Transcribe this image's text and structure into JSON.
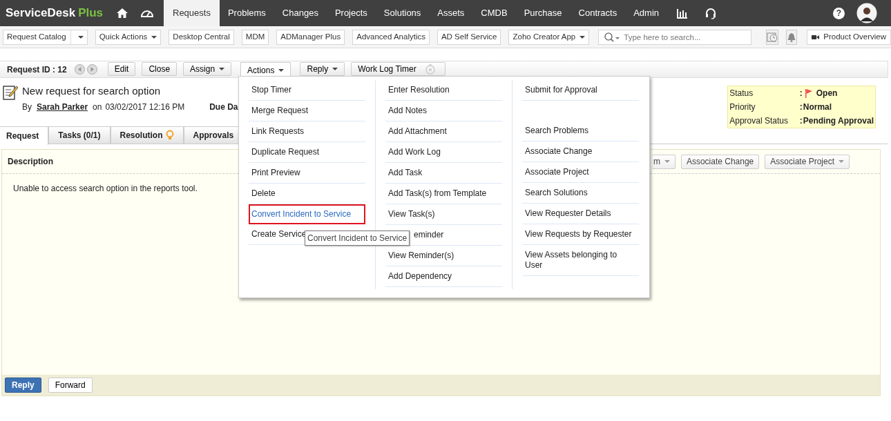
{
  "header": {
    "logo_main": "ServiceDesk",
    "logo_accent": "Plus",
    "help": "?",
    "nav": [
      {
        "label": "Requests",
        "selected": true
      },
      {
        "label": "Problems",
        "selected": false
      },
      {
        "label": "Changes",
        "selected": false
      },
      {
        "label": "Projects",
        "selected": false
      },
      {
        "label": "Solutions",
        "selected": false
      },
      {
        "label": "Assets",
        "selected": false
      },
      {
        "label": "CMDB",
        "selected": false
      },
      {
        "label": "Purchase",
        "selected": false
      },
      {
        "label": "Contracts",
        "selected": false
      },
      {
        "label": "Admin",
        "selected": false
      }
    ]
  },
  "toolbar": {
    "items": [
      {
        "label": "Request Catalog",
        "kind": "split"
      },
      {
        "label": "Quick Actions",
        "kind": "dropdown"
      },
      {
        "label": "Desktop Central",
        "kind": "plain"
      },
      {
        "label": "MDM",
        "kind": "plain"
      },
      {
        "label": "ADManager Plus",
        "kind": "plain"
      },
      {
        "label": "Advanced Analytics",
        "kind": "plain"
      },
      {
        "label": "AD Self Service",
        "kind": "plain"
      },
      {
        "label": "Zoho Creator App",
        "kind": "dropdown"
      }
    ],
    "search": {
      "placeholder": "Type here to search..."
    },
    "product_overview": "Product Overview"
  },
  "request_bar": {
    "id_label": "Request ID : 12",
    "buttons": [
      {
        "label": "Edit",
        "dropdown": false,
        "active": false
      },
      {
        "label": "Close",
        "dropdown": false,
        "active": false
      },
      {
        "label": "Assign",
        "dropdown": true,
        "active": false
      },
      {
        "label": "Actions",
        "dropdown": true,
        "active": true
      },
      {
        "label": "Reply",
        "dropdown": true,
        "active": false
      }
    ],
    "timer": "Work Log Timer"
  },
  "request": {
    "title": "New request for search option",
    "by": "By",
    "author": "Sarah Parker",
    "on": "on",
    "date": "03/02/2017 12:16 PM",
    "due": "Due Da"
  },
  "summary": [
    {
      "label": "Status",
      "colon": ":",
      "value": "Open",
      "flag": true
    },
    {
      "label": "Priority",
      "colon": ":",
      "value": "Normal",
      "flag": false
    },
    {
      "label": "Approval Status",
      "colon": ":",
      "value": "Pending Approval",
      "flag": false
    }
  ],
  "tabs": [
    {
      "label": "Request",
      "selected": true,
      "bulb": false
    },
    {
      "label": "Tasks (0/1)",
      "selected": false,
      "bulb": false
    },
    {
      "label": "Resolution",
      "selected": false,
      "bulb": true
    },
    {
      "label": "Approvals",
      "selected": false,
      "bulb": false
    }
  ],
  "panel": {
    "heading": "Description",
    "buttons": [
      {
        "label": "m",
        "dropdown": true
      },
      {
        "label": "Associate Change",
        "dropdown": false
      },
      {
        "label": "Associate Project",
        "dropdown": true
      }
    ],
    "body": "Unable to access search option in the reports tool.",
    "footer": [
      {
        "label": "Reply",
        "primary": true
      },
      {
        "label": "Forward",
        "primary": false
      }
    ]
  },
  "actions_menu": {
    "tooltip": "Convert Incident to Service",
    "columns": [
      [
        {
          "label": "Stop Timer",
          "kind": "item",
          "highlighted": false
        },
        {
          "label": "Merge Request",
          "kind": "item",
          "highlighted": false
        },
        {
          "label": "Link Requests",
          "kind": "item",
          "highlighted": false
        },
        {
          "label": "Duplicate Request",
          "kind": "item",
          "highlighted": false
        },
        {
          "label": "Print Preview",
          "kind": "item",
          "highlighted": false
        },
        {
          "label": "Delete",
          "kind": "item",
          "highlighted": false
        },
        {
          "label": "Convert Incident to Service",
          "kind": "item",
          "highlighted": true
        },
        {
          "label": "Create Service",
          "kind": "item",
          "highlighted": false
        }
      ],
      [
        {
          "label": "Enter Resolution",
          "kind": "item",
          "highlighted": false
        },
        {
          "label": "Add Notes",
          "kind": "item",
          "highlighted": false
        },
        {
          "label": "Add Attachment",
          "kind": "item",
          "highlighted": false
        },
        {
          "label": "Add Work Log",
          "kind": "item",
          "highlighted": false
        },
        {
          "label": "Add Task",
          "kind": "item",
          "highlighted": false
        },
        {
          "label": "Add Task(s) from Template",
          "kind": "item",
          "highlighted": false
        },
        {
          "label": "View Task(s)",
          "kind": "item",
          "highlighted": false
        },
        {
          "label": "eminder",
          "kind": "covered",
          "highlighted": false
        },
        {
          "label": "View Reminder(s)",
          "kind": "item",
          "highlighted": false
        },
        {
          "label": "Add Dependency",
          "kind": "item",
          "highlighted": false
        }
      ],
      [
        {
          "label": "Submit for Approval",
          "kind": "item",
          "highlighted": false
        },
        {
          "kind": "gap"
        },
        {
          "label": "Search Problems",
          "kind": "item",
          "highlighted": false
        },
        {
          "label": "Associate Change",
          "kind": "item",
          "highlighted": false
        },
        {
          "label": "Associate Project",
          "kind": "item",
          "highlighted": false
        },
        {
          "label": "Search Solutions",
          "kind": "item",
          "highlighted": false
        },
        {
          "label": "View Requester Details",
          "kind": "item",
          "highlighted": false
        },
        {
          "label": "View Requests by Requester",
          "kind": "item",
          "highlighted": false
        },
        {
          "label": "View Assets belonging to User",
          "kind": "item",
          "highlighted": false
        }
      ]
    ]
  }
}
